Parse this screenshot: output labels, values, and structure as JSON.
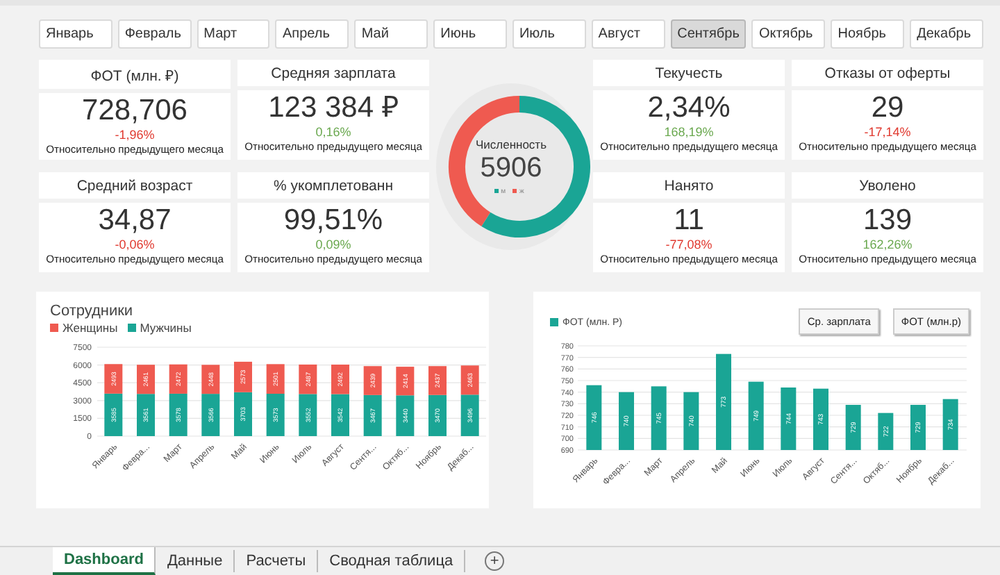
{
  "months": [
    {
      "label": "Январь",
      "selected": false
    },
    {
      "label": "Февраль",
      "selected": false
    },
    {
      "label": "Март",
      "selected": false
    },
    {
      "label": "Апрель",
      "selected": false
    },
    {
      "label": "Май",
      "selected": false
    },
    {
      "label": "Июнь",
      "selected": false
    },
    {
      "label": "Июль",
      "selected": false
    },
    {
      "label": "Август",
      "selected": false
    },
    {
      "label": "Сентябрь",
      "selected": true
    },
    {
      "label": "Октябрь",
      "selected": false
    },
    {
      "label": "Ноябрь",
      "selected": false
    },
    {
      "label": "Декабрь",
      "selected": false
    }
  ],
  "kpis": [
    {
      "title": "ФОТ (млн. ₽)",
      "value": "728,706",
      "delta": "-1,96%",
      "positive": false,
      "note": "Относительно предыдущего месяца"
    },
    {
      "title": "Средняя зарплата",
      "value": "123 384 ₽",
      "delta": "0,16%",
      "positive": true,
      "note": "Относительно предыдущего месяца"
    },
    {
      "title": "Текучесть",
      "value": "2,34%",
      "delta": "168,19%",
      "positive": true,
      "note": "Относительно предыдущего месяца"
    },
    {
      "title": "Отказы от оферты",
      "value": "29",
      "delta": "-17,14%",
      "positive": false,
      "note": "Относительно предыдущего месяца"
    },
    {
      "title": "Средний возраст",
      "value": "34,87",
      "delta": "-0,06%",
      "positive": false,
      "note": "Относительно предыдущего месяца"
    },
    {
      "title": "% укомплетованн",
      "value": "99,51%",
      "delta": "0,09%",
      "positive": true,
      "note": "Относительно предыдущего месяца"
    },
    {
      "title": "Нанято",
      "value": "11",
      "delta": "-77,08%",
      "positive": false,
      "note": "Относительно предыдущего месяца"
    },
    {
      "title": "Уволено",
      "value": "139",
      "delta": "162,26%",
      "positive": true,
      "note": "Относительно предыдущего месяца"
    }
  ],
  "headcount": {
    "title": "Численность",
    "value": "5906",
    "legend": [
      {
        "label": "м",
        "color": "#1aa595"
      },
      {
        "label": "ж",
        "color": "#ef5a50"
      }
    ]
  },
  "employees_chart": {
    "chart_data": {
      "type": "bar",
      "title": "Сотрудники",
      "stacked": true,
      "categories": [
        "Январь",
        "Февра...",
        "Март",
        "Апрель",
        "Май",
        "Июнь",
        "Июль",
        "Август",
        "Сентя...",
        "Октяб...",
        "Ноябрь",
        "Декаб..."
      ],
      "ylim": [
        0,
        7500
      ],
      "grid": true,
      "yticks": [
        0,
        1500,
        3000,
        4500,
        6000,
        7500
      ],
      "data_labels": true,
      "series": [
        {
          "name": "Мужчины",
          "color": "#1aa595",
          "values": [
            3585,
            3561,
            3578,
            3566,
            3703,
            3573,
            3552,
            3542,
            3467,
            3440,
            3470,
            3496
          ]
        },
        {
          "name": "Женщины",
          "color": "#ef5a50",
          "values": [
            2493,
            2461,
            2472,
            2448,
            2573,
            2501,
            2487,
            2492,
            2439,
            2414,
            2437,
            2463
          ]
        }
      ]
    }
  },
  "fot_chart": {
    "buttons": [
      "Ср. зарплата",
      "ФОТ (млн.р)"
    ],
    "chart_data": {
      "type": "bar",
      "categories": [
        "Январь",
        "Февра...",
        "Март",
        "Апрель",
        "Май",
        "Июнь",
        "Июль",
        "Август",
        "Сентя...",
        "Октяб...",
        "Ноябрь",
        "Декаб..."
      ],
      "ylim": [
        690,
        780
      ],
      "grid": true,
      "yticks": [
        690,
        700,
        710,
        720,
        730,
        740,
        750,
        760,
        770,
        780
      ],
      "data_labels": true,
      "series": [
        {
          "name": "ФОТ (млн. Р)",
          "color": "#1aa595",
          "values": [
            746,
            740,
            745,
            740,
            773,
            749,
            744,
            743,
            729,
            722,
            729,
            734
          ]
        }
      ]
    }
  },
  "sheets": [
    {
      "label": "Dashboard",
      "selected": true
    },
    {
      "label": "Данные",
      "selected": false
    },
    {
      "label": "Расчеты",
      "selected": false
    },
    {
      "label": "Сводная таблица",
      "selected": false
    }
  ],
  "add_sheet": "+"
}
